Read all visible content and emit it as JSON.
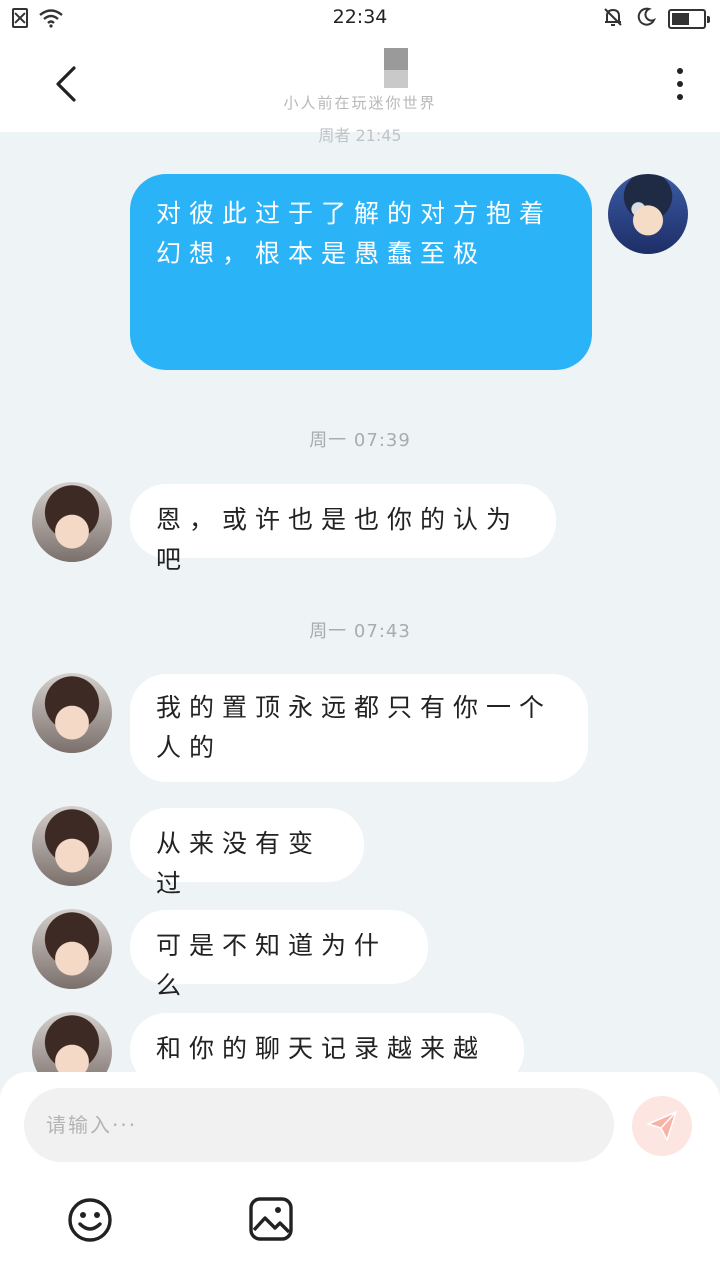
{
  "status_bar": {
    "time": "22:34",
    "battery_level": 0.55,
    "icons": [
      "sim-error-icon",
      "wifi-icon",
      "mute-bell-icon",
      "moon-icon",
      "battery-icon"
    ]
  },
  "header": {
    "subtitle": "小人前在玩迷你世界",
    "icons": [
      "back-arrow-icon",
      "more-vertical-icon"
    ]
  },
  "faded_timestamp": "周者 21:45",
  "messages": {
    "m1": {
      "text": "对彼此过于了解的对方抱着幻想，根本是愚蠢至极"
    },
    "ts1": "周一 07:39",
    "m2": {
      "text": "恩，或许也是也你的认为吧"
    },
    "ts2": "周一 07:43",
    "m3": {
      "text": "我的置顶永远都只有你一个人的"
    },
    "m4": {
      "text": "从来没有变过"
    },
    "m5": {
      "text": "可是不知道为什么"
    },
    "m6": {
      "text": "和你的聊天记录越来越少"
    }
  },
  "composer": {
    "placeholder": "请输入···",
    "icons": [
      "send-icon",
      "emoji-icon",
      "image-icon"
    ]
  },
  "colors": {
    "outgoing_bubble": "#2bb3f8",
    "incoming_bubble": "#ffffff",
    "background": "#eef3f5",
    "send_button": "#fde5e1"
  }
}
